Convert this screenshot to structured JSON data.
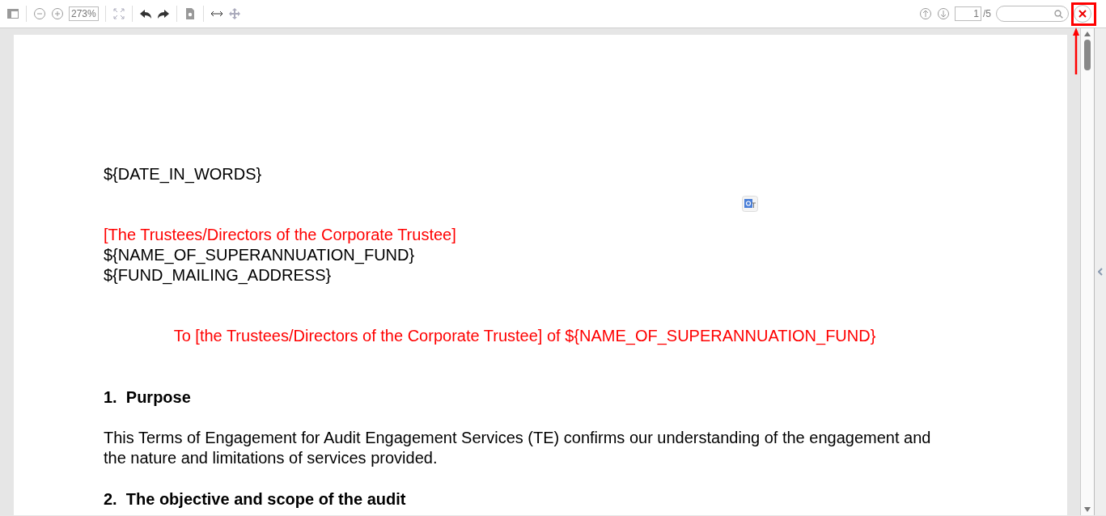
{
  "toolbar": {
    "zoom": "273%",
    "page_input": "1",
    "page_total": "/5"
  },
  "document": {
    "date": "${DATE_IN_WORDS}",
    "address_lines": [
      {
        "text": "[The Trustees/Directors of the Corporate Trustee]",
        "kind": "optional"
      },
      {
        "text": "${NAME_OF_SUPERANNUATION_FUND}",
        "kind": "normal"
      },
      {
        "text": "${FUND_MAILING_ADDRESS}",
        "kind": "normal"
      }
    ],
    "salutation": {
      "text": "To [the Trustees/Directors of the Corporate Trustee] of ${NAME_OF_SUPERANNUATION_FUND}",
      "kind": "optional"
    },
    "sections": [
      {
        "heading": "1.  Purpose",
        "body": "This Terms of Engagement for Audit Engagement Services (TE) confirms our understanding of the engagement and the nature and limitations of services provided."
      },
      {
        "heading": "2.  The objective and scope of the audit"
      }
    ]
  }
}
